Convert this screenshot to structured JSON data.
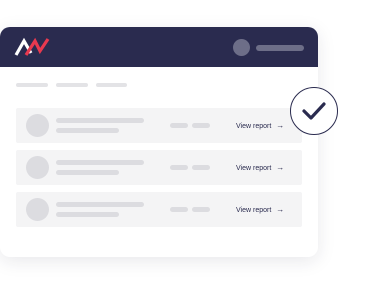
{
  "brand": {
    "logo_icon": "brand-logo-icon",
    "colors": {
      "navy": "#2a2b4f",
      "red": "#e8394f"
    }
  },
  "header": {
    "avatar_icon": "user-avatar-icon"
  },
  "rows": [
    {
      "link_label": "View report",
      "arrow": "→"
    },
    {
      "link_label": "View report",
      "arrow": "→"
    },
    {
      "link_label": "View report",
      "arrow": "→"
    }
  ],
  "status": {
    "icon": "checkmark-icon"
  }
}
